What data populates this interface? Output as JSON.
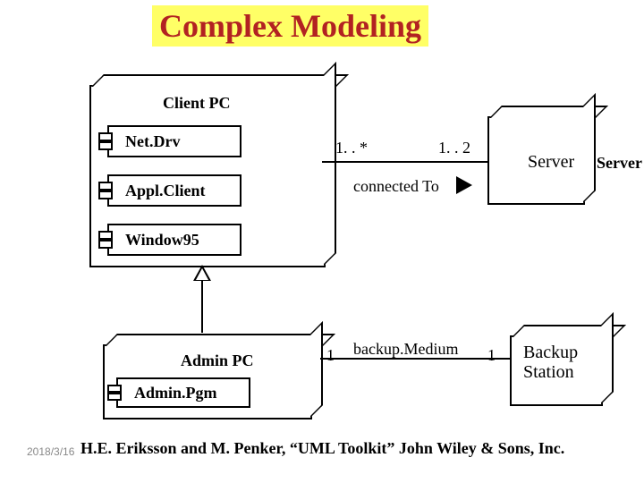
{
  "title": "Complex Modeling",
  "nodes": {
    "client_pc": {
      "label": "Client PC"
    },
    "admin_pc": {
      "label": "Admin PC"
    },
    "server": {
      "label": "Server"
    },
    "backup_station": {
      "label": "Backup\nStation"
    }
  },
  "components": {
    "net_drv": "Net.Drv",
    "appl_client": "Appl.Client",
    "window95": "Window95",
    "admin_pgm": "Admin.Pgm"
  },
  "associations": {
    "connected_to": {
      "label": "connected To",
      "mult_left": "1. . *",
      "mult_right": "1. . 2"
    },
    "backup_medium": {
      "label": "backup.Medium",
      "mult_left": "1",
      "mult_right": "1"
    }
  },
  "footer": {
    "citation": "H.E. Eriksson and M. Penker, “UML Toolkit” John Wiley & Sons, Inc.",
    "date": "2018/3/16"
  }
}
